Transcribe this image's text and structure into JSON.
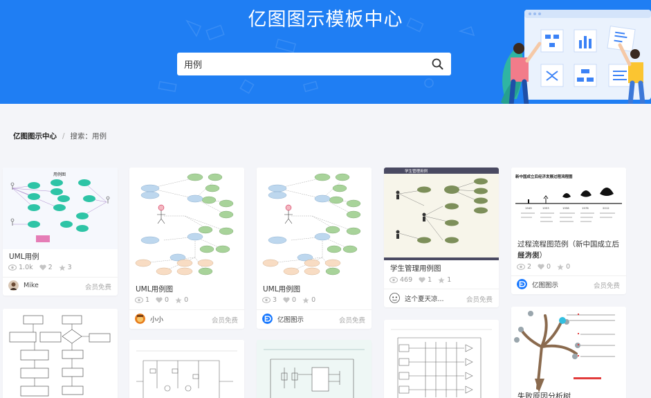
{
  "hero": {
    "title": "亿图图示模板中心",
    "search_value": "用例"
  },
  "breadcrumb": {
    "home": "亿图图示中心",
    "separator": "/",
    "current": "搜索：用例"
  },
  "cards": [
    {
      "title": "UML用例",
      "views": "1.0k",
      "likes": "2",
      "stars": "3",
      "author": "Mike",
      "badge": "会员免费"
    },
    {
      "title": "UML用例图",
      "views": "1",
      "likes": "0",
      "stars": "0",
      "author": "小小",
      "badge": "会员免费"
    },
    {
      "title": "UML用例图",
      "views": "3",
      "likes": "0",
      "stars": "0",
      "author": "亿图图示",
      "badge": "会员免费"
    },
    {
      "title": "学生管理用例图",
      "views": "469",
      "likes": "1",
      "stars": "1",
      "author": "这个夏天凉...",
      "badge": "会员免费"
    },
    {
      "title_line1": "过程流程图范例（新中国成立后经济发",
      "title_line2": "展为例）",
      "views": "2",
      "likes": "0",
      "stars": "0",
      "author": "亿图图示",
      "badge": "会员免费"
    },
    {
      "title": "失败原因分析树"
    }
  ],
  "thumbs": {
    "card1_title": "用例图",
    "card4_header": "学生管理用例",
    "card5_title": "新中国成立后经济发展过程流程图",
    "card5_years": [
      "1949",
      "1953",
      "1958",
      "1978",
      "2012"
    ]
  },
  "colors": {
    "hero_bg": "#1f7ef3",
    "teal_node": "#2ec4a6",
    "olive_node": "#7d8f5a",
    "edraw_blue": "#1677ff"
  }
}
